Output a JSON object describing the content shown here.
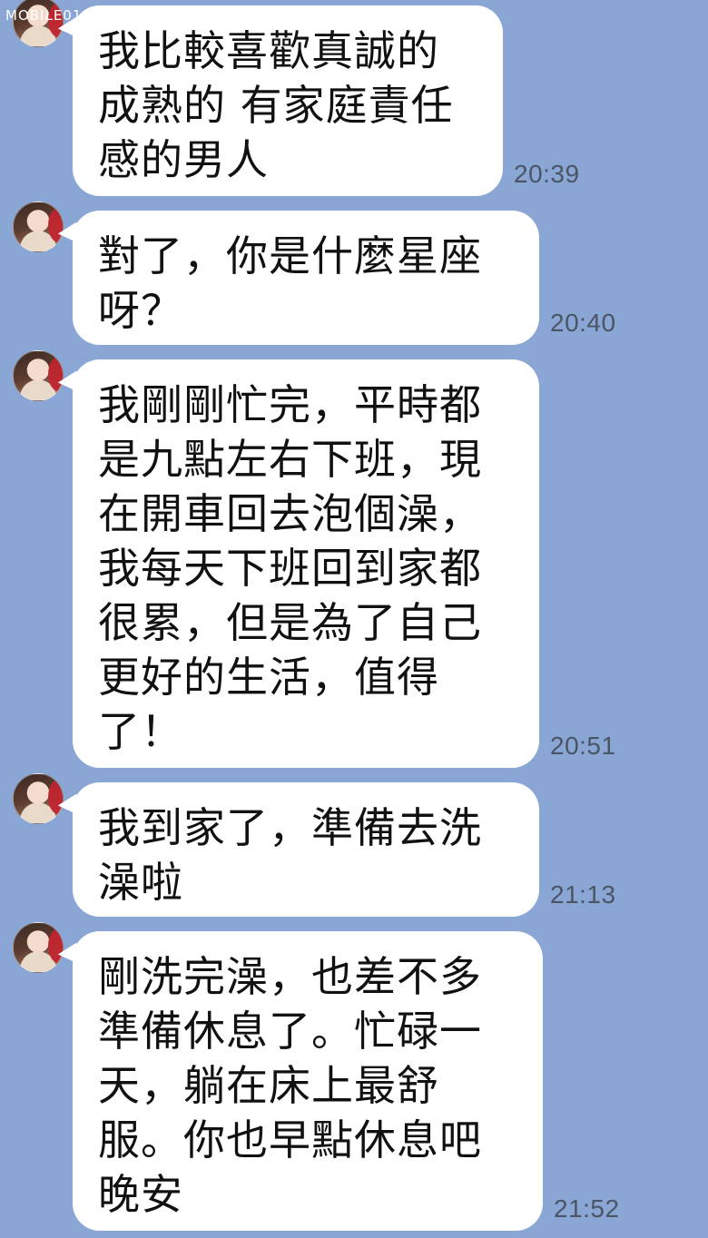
{
  "watermark": {
    "text": "MOBILE01"
  },
  "messages": [
    {
      "text": "我比較喜歡真誠的\n成熟的 有家庭責任\n感的男人",
      "time": "20:39"
    },
    {
      "text": "對了，你是什麼星座\n呀？",
      "time": "20:40"
    },
    {
      "text": "我剛剛忙完，平時都\n是九點左右下班，現\n在開車回去泡個澡，\n我每天下班回到家都\n很累，但是為了自己\n更好的生活，值得\n了！",
      "time": "20:51"
    },
    {
      "text": "我到家了，準備去洗\n澡啦",
      "time": "21:13"
    },
    {
      "text": "剛洗完澡，也差不多\n準備休息了。忙碌一\n天，躺在床上最舒\n服。你也早點休息吧\n晚安",
      "time": "21:52"
    }
  ]
}
